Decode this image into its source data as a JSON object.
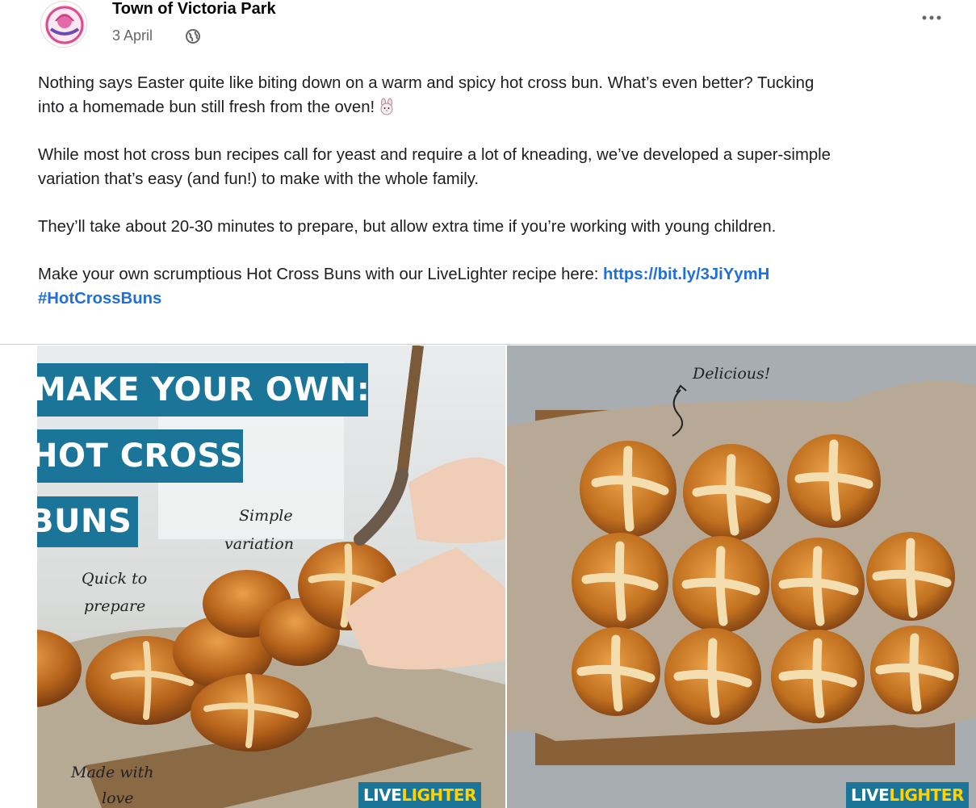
{
  "post": {
    "page_name": "Town of Victoria Park",
    "date": "3 April",
    "paragraphs": [
      [
        "Nothing says Easter quite like biting down on a warm and spicy hot cross bun. What’s even better? Tucking",
        "into a homemade bun still fresh from the oven!"
      ],
      [
        "While most hot cross bun recipes call for yeast and require a lot of kneading, we’ve developed a super-simple",
        "variation that’s easy (and fun!) to make with the whole family."
      ],
      [
        "They’ll take about 20-30 minutes to prepare, but allow extra time if you’re working with young children."
      ]
    ],
    "cta_text": "Make your own scrumptious Hot Cross Buns with our LiveLighter recipe here: ",
    "link": "https://bit.ly/3JiYymH",
    "hashtag": "#HotCrossBuns"
  },
  "images": {
    "left": {
      "banner_lines": [
        "MAKE YOUR OWN:",
        "HOT CROSS",
        "BUNS"
      ],
      "annotations": {
        "simple": "Simple",
        "variation": "variation",
        "quick": "Quick to",
        "prepare": "prepare",
        "made": "Made with",
        "love": "love"
      },
      "brand_a": "LIVE",
      "brand_b": "LIGHTER"
    },
    "right": {
      "annotation": "Delicious!",
      "brand_a": "LIVE",
      "brand_b": "LIGHTER"
    }
  },
  "icons": [
    "town-logo-icon",
    "globe-icon",
    "more-options-icon",
    "bunny-emoji-icon"
  ],
  "colors": {
    "link": "#216fdb",
    "banner": "#1a7599",
    "brand_yellow": "#ffd200"
  }
}
